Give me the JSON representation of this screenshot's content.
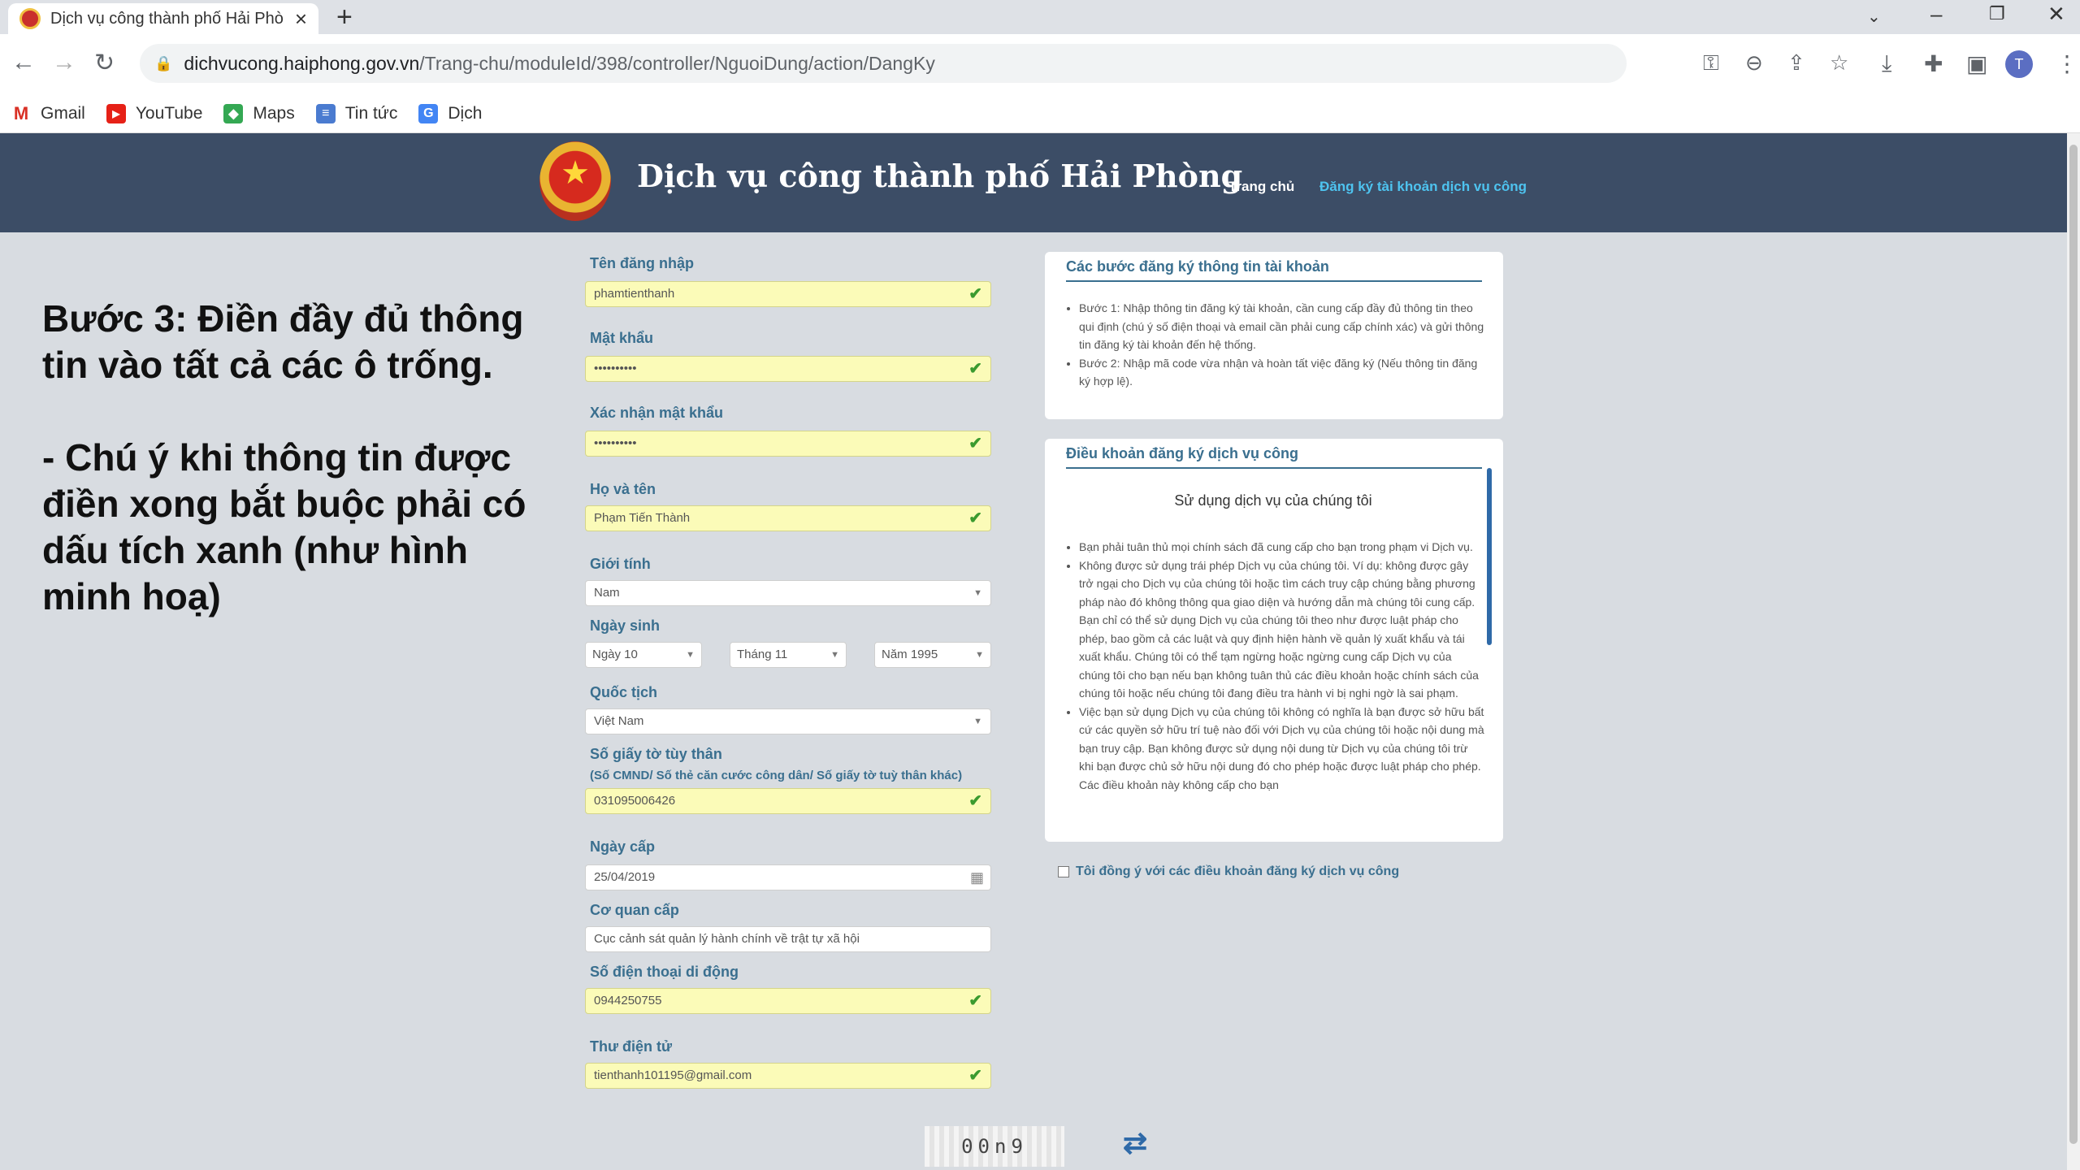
{
  "browser": {
    "tab_title": "Dịch vụ công thành phố Hải Phò",
    "url_host": "dichvucong.haiphong.gov.vn",
    "url_path": "/Trang-chu/moduleId/398/controller/NguoiDung/action/DangKy",
    "profile_initial": "T",
    "bookmarks": [
      "Gmail",
      "YouTube",
      "Maps",
      "Tin tức",
      "Dịch"
    ]
  },
  "site": {
    "title": "Dịch vụ công thành phố Hải Phòng",
    "menu_home": "Trang chủ",
    "menu_register": "Đăng ký tài khoản dịch vụ công"
  },
  "note": "Bước 3: Điền đầy đủ thông tin vào tất cả các ô trống.\n\n- Chú ý khi thông tin được điền xong bắt buộc phải có dấu tích xanh (như hình minh hoạ)",
  "form": {
    "username_label": "Tên đăng nhập",
    "username_value": "phamtienthanh",
    "password_label": "Mật khẩu",
    "password_value": "••••••••••",
    "confirm_label": "Xác nhận mật khẩu",
    "confirm_value": "••••••••••",
    "fullname_label": "Họ và tên",
    "fullname_value": "Phạm Tiến Thành",
    "gender_label": "Giới tính",
    "gender_value": "Nam",
    "dob_label": "Ngày sinh",
    "dob_day": "Ngày 10",
    "dob_month": "Tháng 11",
    "dob_year": "Năm 1995",
    "nationality_label": "Quốc tịch",
    "nationality_value": "Việt Nam",
    "id_label": "Số giấy tờ tùy thân",
    "id_hint": "(Số CMND/ Số thẻ căn cước công dân/ Số giấy tờ tuỳ thân khác)",
    "id_value": "031095006426",
    "issue_date_label": "Ngày cấp",
    "issue_date_value": "25/04/2019",
    "issuer_label": "Cơ quan cấp",
    "issuer_value": "Cục cảnh sát quản lý hành chính về trật tự xã hội",
    "phone_label": "Số điện thoại di động",
    "phone_value": "0944250755",
    "email_label": "Thư điện tử",
    "email_value": "tienthanh101195@gmail.com"
  },
  "steps_panel": {
    "title": "Các bước đăng ký thông tin tài khoản",
    "items": [
      "Bước 1: Nhập thông tin đăng ký tài khoản, cần cung cấp đầy đủ thông tin theo qui định (chú ý số điện thoại và email cần phải cung cấp chính xác) và gửi thông tin đăng ký tài khoản đến hệ thống.",
      "Bước 2: Nhập mã code vừa nhận và hoàn tất việc đăng ký (Nếu thông tin đăng ký hợp lệ)."
    ]
  },
  "terms_panel": {
    "title": "Điều khoản đăng ký dịch vụ công",
    "subtitle": "Sử dụng dịch vụ của chúng tôi",
    "items": [
      "Bạn phải tuân thủ mọi chính sách đã cung cấp cho bạn trong phạm vi Dịch vụ.",
      "Không được sử dụng trái phép Dịch vụ của chúng tôi. Ví dụ: không được gây trở ngại cho Dịch vụ của chúng tôi hoặc tìm cách truy cập chúng bằng phương pháp nào đó không thông qua giao diện và hướng dẫn mà chúng tôi cung cấp. Bạn chỉ có thể sử dụng Dịch vụ của chúng tôi theo như được luật pháp cho phép, bao gồm cả các luật và quy định hiện hành về quản lý xuất khẩu và tái xuất khẩu. Chúng tôi có thể tạm ngừng hoặc ngừng cung cấp Dịch vụ của chúng tôi cho bạn nếu bạn không tuân thủ các điều khoản hoặc chính sách của chúng tôi hoặc nếu chúng tôi đang điều tra hành vi bị nghi ngờ là sai phạm.",
      "Việc bạn sử dụng Dịch vụ của chúng tôi không có nghĩa là bạn được sở hữu bất cứ các quyền sở hữu trí tuệ nào đối với Dịch vụ của chúng tôi hoặc nội dung mà bạn truy cập. Bạn không được sử dụng nội dung từ Dịch vụ của chúng tôi trừ khi bạn được chủ sở hữu nội dung đó cho phép hoặc được luật pháp cho phép. Các điều khoản này không cấp cho bạn"
    ]
  },
  "agree_label": "Tôi đồng ý với các điều khoản đăng ký dịch vụ công",
  "captcha_text": "00n9"
}
